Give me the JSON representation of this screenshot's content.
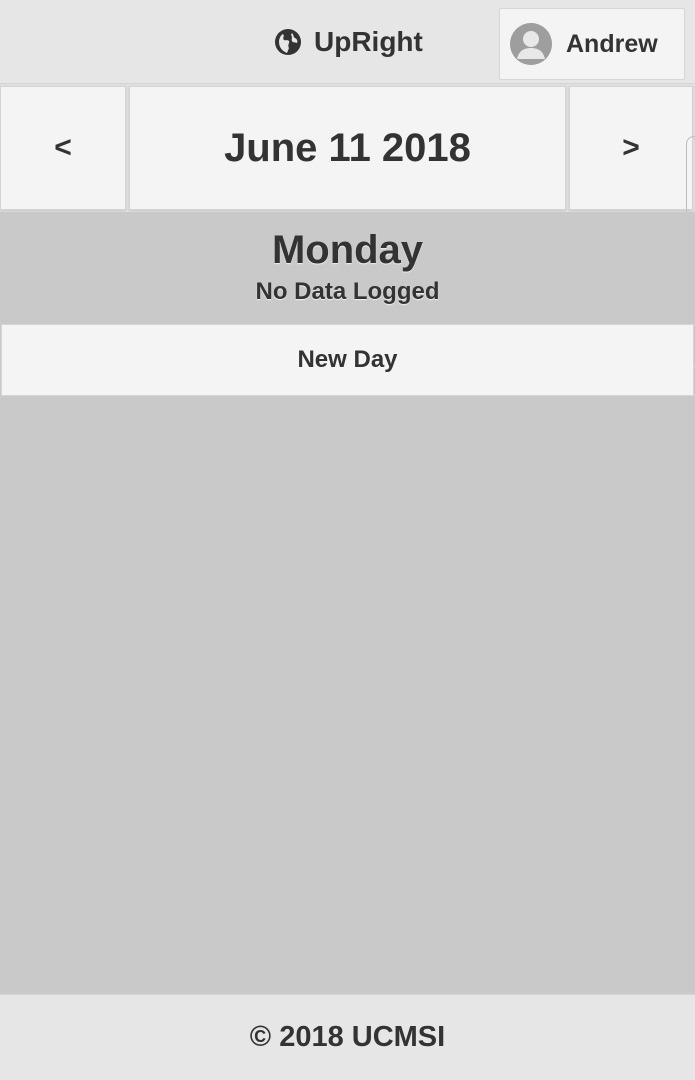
{
  "header": {
    "brand_icon": "globe-icon",
    "brand_name": "UpRight",
    "user": {
      "avatar_icon": "user-avatar-icon",
      "name": "Andrew"
    }
  },
  "date_nav": {
    "prev_label": "<",
    "date": "June 11 2018",
    "next_label": ">"
  },
  "day": {
    "weekday": "Monday",
    "status": "No Data Logged"
  },
  "actions": {
    "new_day_label": "New Day"
  },
  "footer": {
    "copyright": "© 2018 UCMSI"
  },
  "colors": {
    "background": "#c9c9c9",
    "header_bg": "#e6e6e6",
    "button_bg": "#f4f4f4",
    "text": "#333333"
  }
}
